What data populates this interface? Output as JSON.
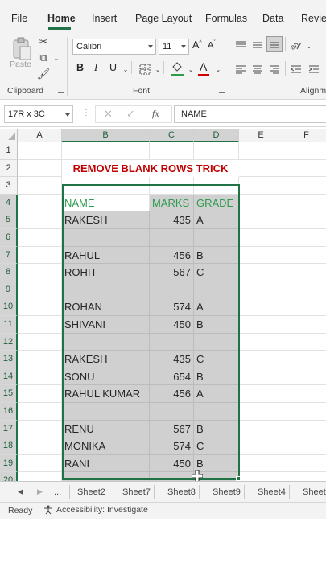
{
  "menu": {
    "tabs": [
      "File",
      "Home",
      "Insert",
      "Page Layout",
      "Formulas",
      "Data",
      "Review"
    ],
    "active": "Home"
  },
  "ribbon": {
    "clipboard_label": "Clipboard",
    "paste_label": "Paste",
    "font_label": "Font",
    "alignment_label": "Alignm",
    "font_name": "Calibri",
    "font_size": "11",
    "bold": "B",
    "italic": "I",
    "underline": "U",
    "font_color_accent": "#d00000",
    "fill_color_accent": "#2e9c4f"
  },
  "formula_bar": {
    "name_box": "17R x 3C",
    "fx": "fx",
    "content": "NAME"
  },
  "grid": {
    "columns": [
      "A",
      "B",
      "C",
      "D",
      "E",
      "F"
    ],
    "rows": [
      "1",
      "2",
      "3",
      "4",
      "5",
      "6",
      "7",
      "8",
      "9",
      "10",
      "11",
      "12",
      "13",
      "14",
      "15",
      "16",
      "17",
      "18",
      "19",
      "20"
    ],
    "title": "REMOVE BLANK ROWS TRICK",
    "headers": [
      "NAME",
      "MARKS",
      "GRADE"
    ],
    "data": [
      [
        "RAKESH",
        "435",
        "A"
      ],
      [
        "",
        "",
        ""
      ],
      [
        "RAHUL",
        "456",
        "B"
      ],
      [
        "ROHIT",
        "567",
        "C"
      ],
      [
        "",
        "",
        ""
      ],
      [
        "ROHAN",
        "574",
        "A"
      ],
      [
        "SHIVANI",
        "450",
        "B"
      ],
      [
        "",
        "",
        ""
      ],
      [
        "RAKESH",
        "435",
        "C"
      ],
      [
        "SONU",
        "654",
        "B"
      ],
      [
        "RAHUL KUMAR",
        "456",
        "A"
      ],
      [
        "",
        "",
        ""
      ],
      [
        "RENU",
        "567",
        "B"
      ],
      [
        "MONIKA",
        "574",
        "C"
      ],
      [
        "RANI",
        "450",
        "B"
      ],
      [
        "",
        "",
        ""
      ]
    ]
  },
  "sheets": {
    "ellipsis": "...",
    "tabs": [
      "Sheet2",
      "Sheet7",
      "Sheet8",
      "Sheet9",
      "Sheet4",
      "Sheet"
    ]
  },
  "status": {
    "ready": "Ready",
    "accessibility": "Accessibility: Investigate"
  },
  "colors": {
    "excel_green": "#217346",
    "title_red": "#c00000",
    "header_green": "#2e9c4f",
    "selection_gray": "#d0d0d0"
  }
}
